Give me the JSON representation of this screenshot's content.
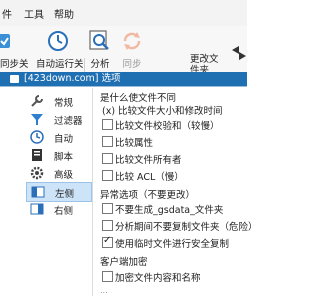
{
  "menu": {
    "item_partial": "件",
    "tools": "工具",
    "help": "帮助"
  },
  "toolbar": {
    "sync_prev": "同步",
    "sync_prev_suffix": "关",
    "auto_run": "自动运行",
    "auto_run_suffix": "关",
    "analyze": "分析",
    "sync": "同步",
    "change_folder_line1": "更改文",
    "change_folder_line2": "件夹",
    "folder_value": "cal"
  },
  "dialog": {
    "title": "[423down.com] 选项",
    "nav": [
      {
        "label": "常规",
        "icon": "wrench-icon"
      },
      {
        "label": "过滤器",
        "icon": "filter-icon"
      },
      {
        "label": "自动",
        "icon": "clock-icon"
      },
      {
        "label": "脚本",
        "icon": "script-icon"
      },
      {
        "label": "高级",
        "icon": "gear-icon"
      },
      {
        "label": "左侧",
        "icon": "left-panel-icon"
      },
      {
        "label": "右侧",
        "icon": "right-panel-icon"
      }
    ],
    "selected_nav": "左侧",
    "section1": {
      "title": "是什么使文件不同",
      "radio_label": "(x) 比较文件大小和修改时间",
      "options": [
        {
          "label": "比较文件校验和（较慢）",
          "checked": false
        },
        {
          "label": "比较属性",
          "checked": false
        },
        {
          "label": "比较文件所有者",
          "checked": false
        },
        {
          "label": "比较 ACL（慢）",
          "checked": false
        }
      ]
    },
    "section2": {
      "title": "异常选项（不要更改）",
      "options": [
        {
          "label": "不要生成_gsdata_文件夹",
          "checked": false
        },
        {
          "label": "分析期间不要复制文件夹（危险）",
          "checked": false
        },
        {
          "label": "使用临时文件进行安全复制",
          "checked": true
        }
      ]
    },
    "section3": {
      "title": "客户端加密",
      "options": [
        {
          "label": "加密文件内容和名称",
          "checked": false
        }
      ]
    },
    "cut_text": "..."
  }
}
